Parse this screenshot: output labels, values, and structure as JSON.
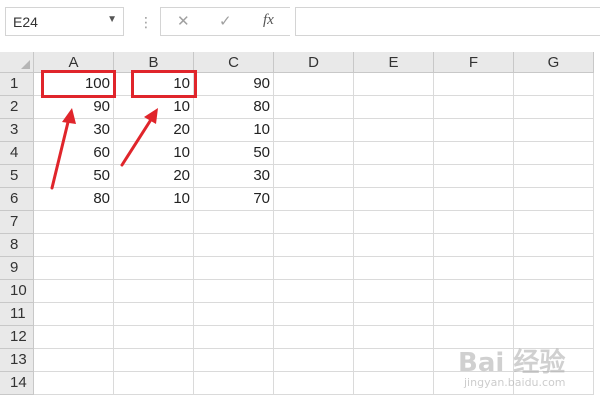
{
  "formula_bar": {
    "name_box": "E24",
    "name_box_caret": "▼",
    "separator": "⋮",
    "cancel_glyph": "✕",
    "enter_glyph": "✓",
    "fx_glyph": "fx",
    "formula_value": ""
  },
  "sheet": {
    "columns": [
      "A",
      "B",
      "C",
      "D",
      "E",
      "F",
      "G"
    ],
    "rows": [
      "1",
      "2",
      "3",
      "4",
      "5",
      "6",
      "7",
      "8",
      "9",
      "10",
      "11",
      "12",
      "13",
      "14"
    ],
    "cells": [
      [
        "100",
        "10",
        "90",
        "",
        "",
        "",
        ""
      ],
      [
        "90",
        "10",
        "80",
        "",
        "",
        "",
        ""
      ],
      [
        "30",
        "20",
        "10",
        "",
        "",
        "",
        ""
      ],
      [
        "60",
        "10",
        "50",
        "",
        "",
        "",
        ""
      ],
      [
        "50",
        "20",
        "30",
        "",
        "",
        "",
        ""
      ],
      [
        "80",
        "10",
        "70",
        "",
        "",
        "",
        ""
      ],
      [
        "",
        "",
        "",
        "",
        "",
        "",
        ""
      ],
      [
        "",
        "",
        "",
        "",
        "",
        "",
        ""
      ],
      [
        "",
        "",
        "",
        "",
        "",
        "",
        ""
      ],
      [
        "",
        "",
        "",
        "",
        "",
        "",
        ""
      ],
      [
        "",
        "",
        "",
        "",
        "",
        "",
        ""
      ],
      [
        "",
        "",
        "",
        "",
        "",
        "",
        ""
      ],
      [
        "",
        "",
        "",
        "",
        "",
        "",
        ""
      ],
      [
        "",
        "",
        "",
        "",
        "",
        "",
        ""
      ]
    ]
  },
  "annotations": {
    "highlight_color": "#e0252b",
    "highlighted_cells": [
      "A1",
      "B1"
    ]
  },
  "watermark": {
    "text": "Bai 经验",
    "sub": "jingyan.baidu.com"
  }
}
